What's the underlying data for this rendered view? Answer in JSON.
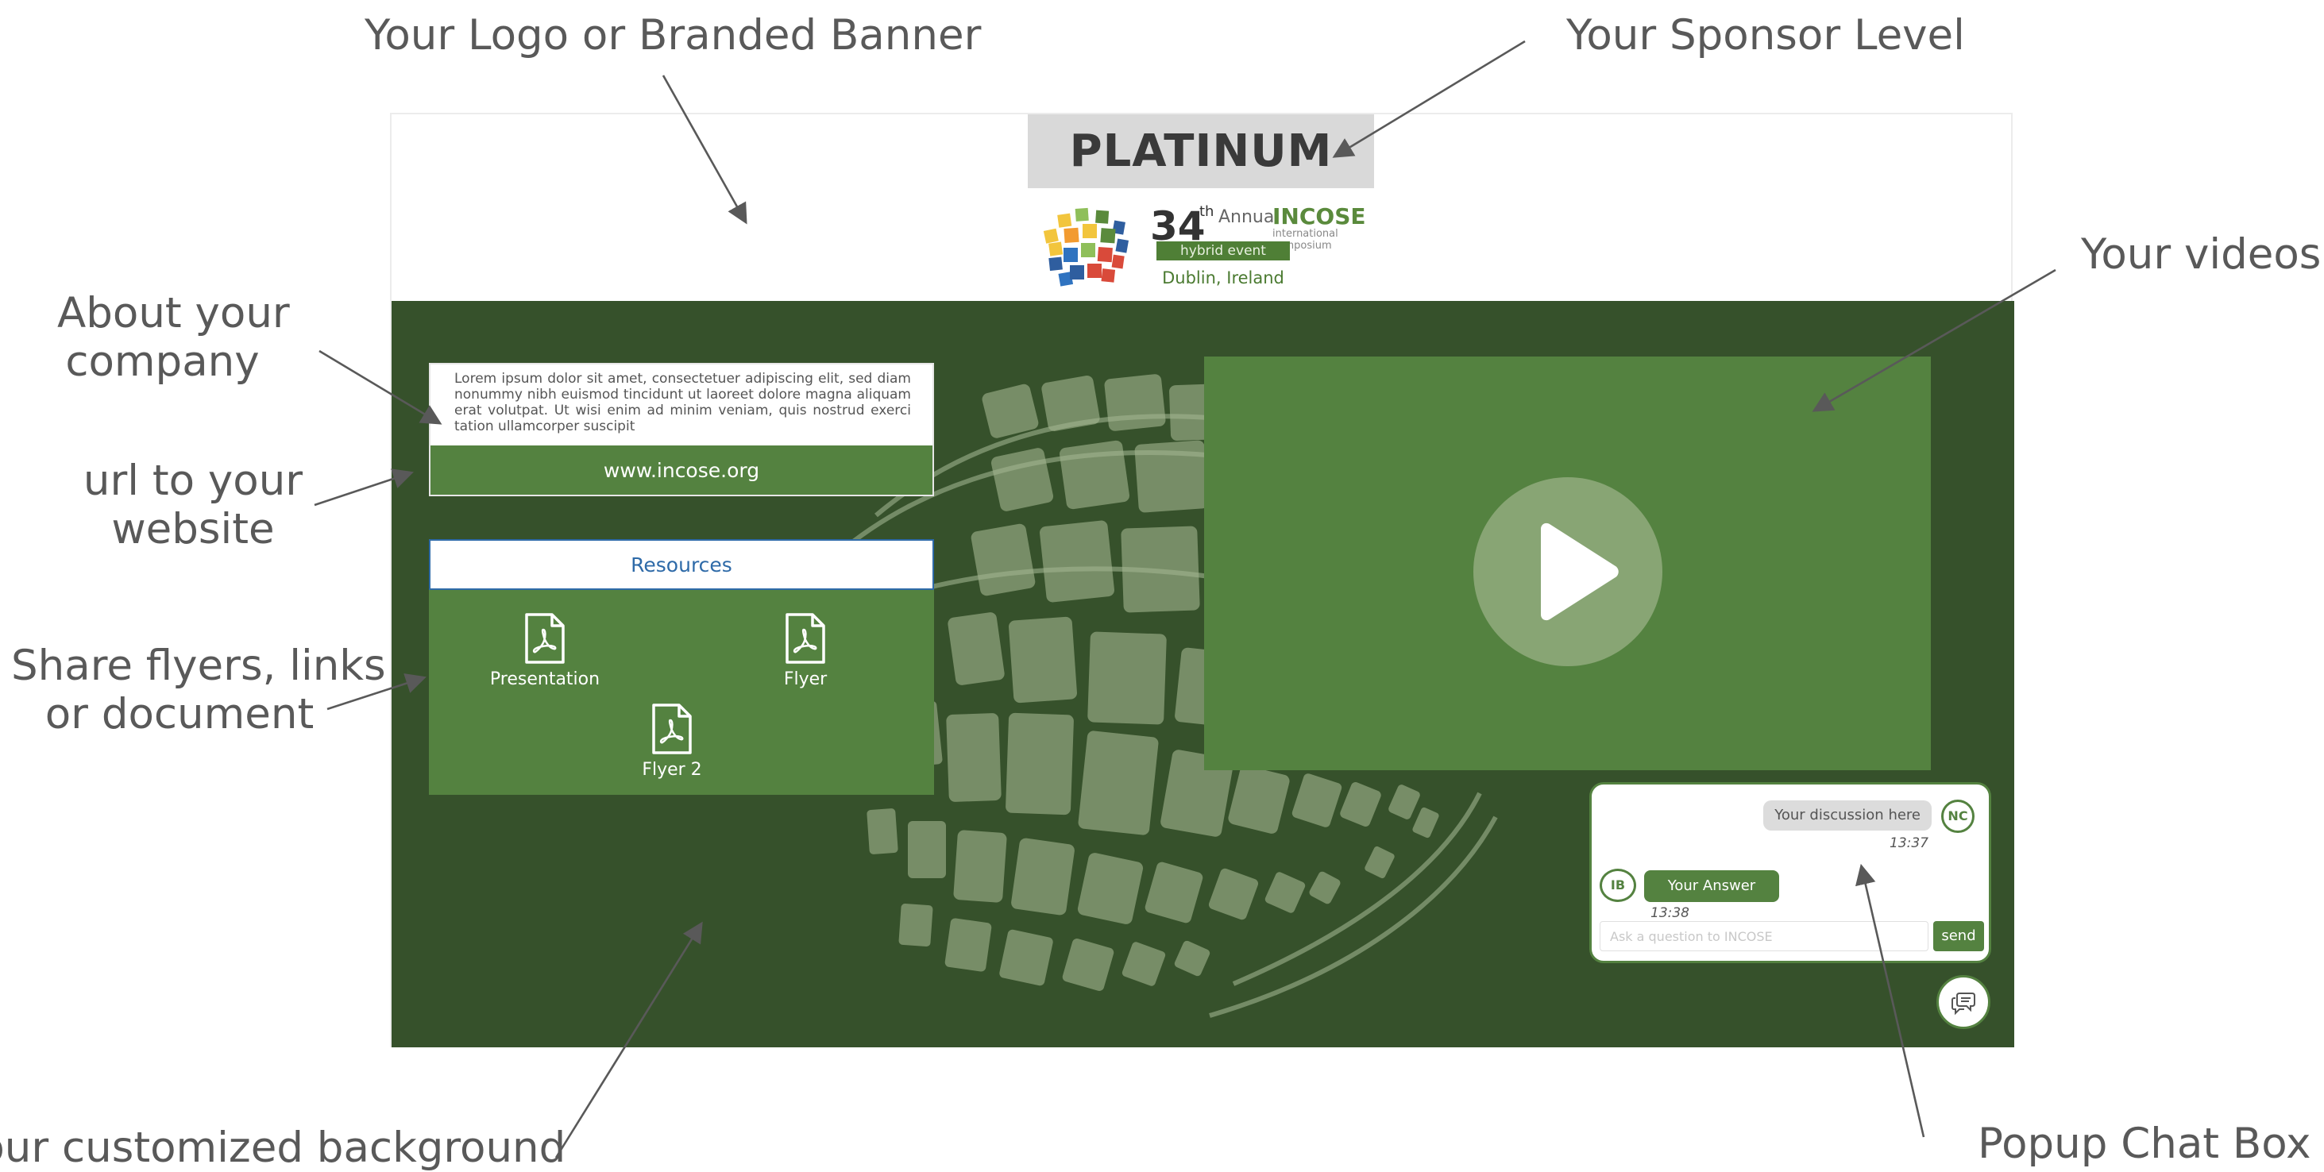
{
  "callouts": {
    "logo_banner": "Your Logo or Branded Banner",
    "sponsor_level": "Your Sponsor Level",
    "about_line1": "About your",
    "about_line2": "company",
    "url_line1": "url to your",
    "url_line2": "website",
    "share_line1": "Share flyers, links",
    "share_line2": "or document",
    "videos": "Your videos",
    "background": "Your customized background",
    "chat": "Popup Chat Box"
  },
  "booth": {
    "sponsor_level": "PLATINUM",
    "logo": {
      "number": "34",
      "suffix": "th",
      "annual": "Annual",
      "brand": "INCOSE",
      "subtitle": "international symposium",
      "badge": "hybrid event",
      "location": "Dublin, Ireland"
    },
    "about_text": "Lorem ipsum dolor sit amet, consectetuer adipiscing elit, sed diam nonummy nibh euismod tincidunt ut laoreet dolore magna aliquam erat volutpat. Ut wisi enim ad minim veniam, quis nostrud exerci tation ullamcorper suscipit",
    "url": "www.incose.org",
    "resources": {
      "tab_label": "Resources",
      "documents": [
        "Presentation",
        "Flyer",
        "Flyer 2"
      ]
    }
  },
  "chat": {
    "messages": [
      {
        "text": "Your discussion here",
        "initials": "NC",
        "time": "13:37"
      },
      {
        "text": "Your Answer",
        "initials": "IB",
        "time": "13:38"
      }
    ],
    "input_placeholder": "Ask a question to INCOSE",
    "send_label": "send"
  },
  "colors": {
    "background_dark_green": "#36512b",
    "panel_green": "#548240",
    "play_circle": "#88a574",
    "level_grey": "#d9d9d9",
    "resources_tab_border": "#2e6aa8"
  },
  "icons": [
    "pdf-file-icon",
    "play-icon",
    "chat-bubble-icon",
    "globe-logo-icon"
  ]
}
